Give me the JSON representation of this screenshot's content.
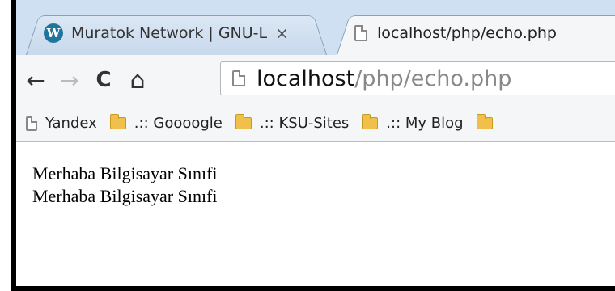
{
  "tabs": [
    {
      "title": "Muratok Network | GNU-L",
      "close": "×",
      "favicon": "wordpress-icon",
      "favicon_glyph": "W"
    },
    {
      "title": "localhost/php/echo.php",
      "favicon": "page-icon"
    }
  ],
  "toolbar": {
    "back": "←",
    "forward": "→",
    "reload": "C",
    "home": "⌂",
    "url_host": "localhost",
    "url_path": "/php/echo.php"
  },
  "bookmarks": [
    {
      "label": "Yandex",
      "icon": "page-icon"
    },
    {
      "label": ".:: Goooogle",
      "icon": "folder-icon"
    },
    {
      "label": ".:: KSU-Sites",
      "icon": "folder-icon"
    },
    {
      "label": ".:: My Blog",
      "icon": "folder-icon"
    }
  ],
  "page": {
    "lines": [
      "Merhaba Bilgisayar Sınıfi",
      "Merhaba Bilgisayar Sınıfi"
    ]
  }
}
